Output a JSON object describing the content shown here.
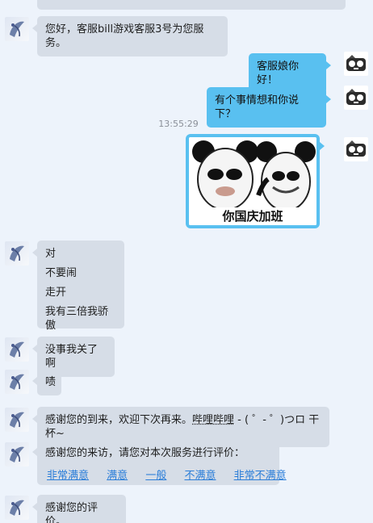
{
  "messages": {
    "greeting": "您好，客服bill游戏客服3号为您服务。",
    "user_1": "客服娘你好！",
    "user_2": "有个事情想和你说下？",
    "timestamp": "13:55:29",
    "sticker_caption": "你国庆加班",
    "reply_lines": [
      "对",
      "不要闹",
      "走开",
      "我有三倍我骄傲"
    ],
    "reply_2": "没事我关了啊",
    "reply_3": "啧",
    "reply_4_prefix": "感谢您的到来，欢迎下次再来。",
    "reply_4_mid": "哔哩哔哩",
    "reply_4_suffix": " - ( ゜- ゜)つロ 干杯~",
    "survey_title": "感谢您的来访，请您对本次服务进行评价：",
    "survey_options": [
      "非常满意",
      "满意",
      "一般",
      "不满意",
      "非常不满意"
    ],
    "final": "感谢您的评价。"
  }
}
